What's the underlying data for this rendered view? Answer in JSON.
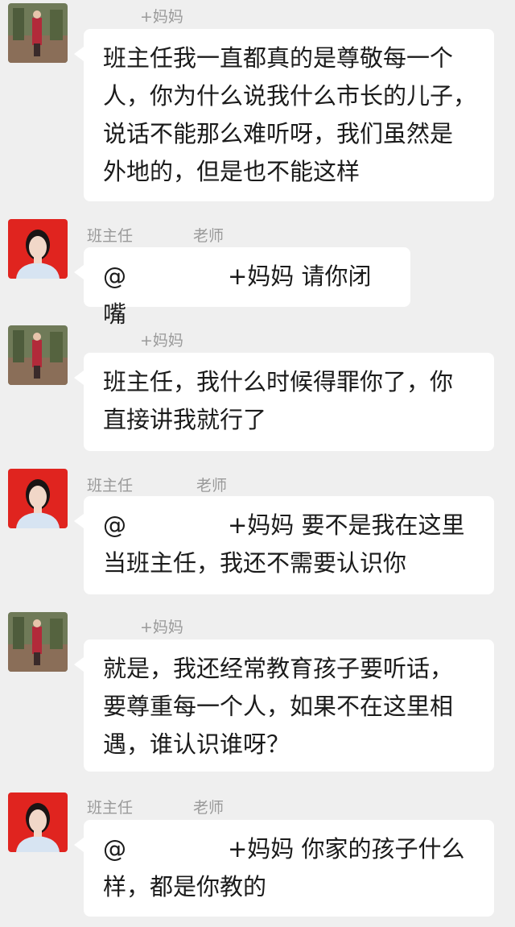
{
  "messages": [
    {
      "sender": "+妈妈",
      "lines": [
        "班主任我一直都真的是尊敬每一个",
        "人，你为什么说我什么市长的儿子，",
        "说话不能那么难听呀，我们虽然是",
        "外地的，但是也不能这样"
      ]
    },
    {
      "sender": "班主任",
      "role": "老师",
      "mention": "@",
      "lines": [
        "+妈妈  请你闭嘴"
      ]
    },
    {
      "sender": "+妈妈",
      "lines": [
        "班主任，我什么时候得罪你了，你",
        "直接讲我就行了"
      ]
    },
    {
      "sender": "班主任",
      "role": "老师",
      "mention": "@",
      "lines": [
        "+妈妈  要不是我在这里",
        "当班主任，我还不需要认识你"
      ]
    },
    {
      "sender": "+妈妈",
      "lines": [
        "就是，我还经常教育孩子要听话，",
        "要尊重每一个人，如果不在这里相",
        "遇，谁认识谁呀？"
      ]
    },
    {
      "sender": "班主任",
      "role": "老师",
      "mention": "@",
      "lines": [
        "+妈妈  你家的孩子什么",
        "样，都是你教的"
      ]
    }
  ]
}
